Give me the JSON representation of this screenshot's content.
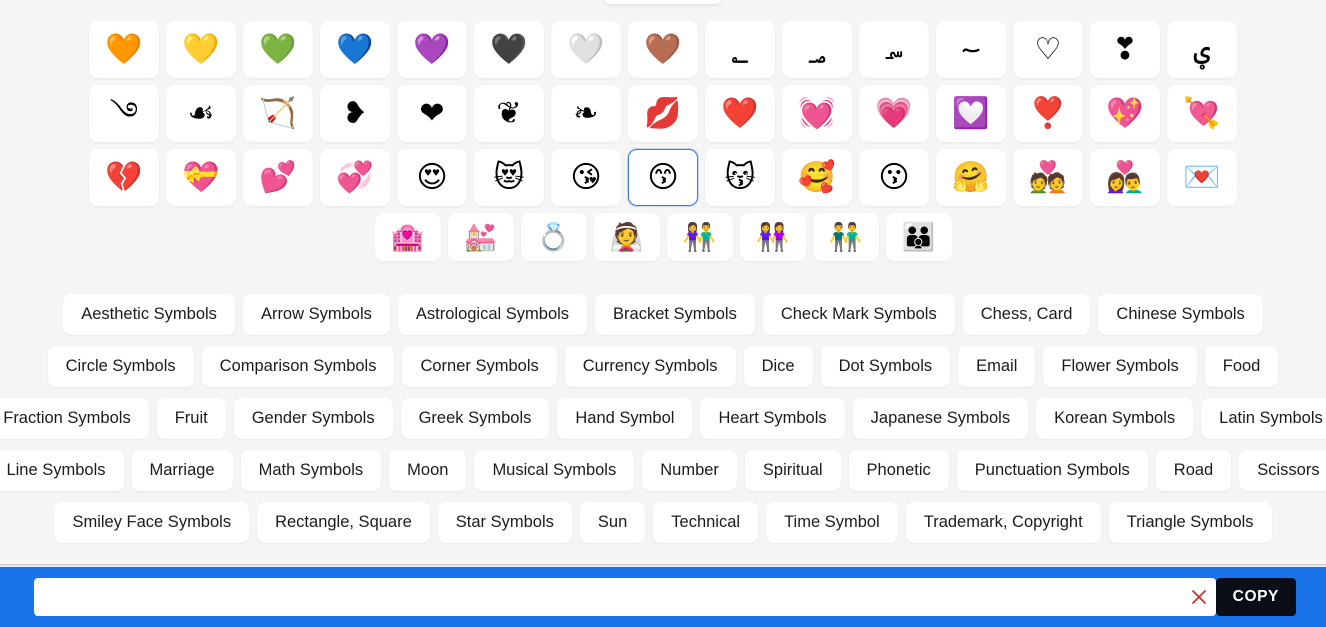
{
  "emoji_grid": {
    "rows": [
      {
        "cells": [
          {
            "glyph": "🧡",
            "name": "orange-heart"
          },
          {
            "glyph": "💛",
            "name": "yellow-heart"
          },
          {
            "glyph": "💚",
            "name": "green-heart"
          },
          {
            "glyph": "💙",
            "name": "blue-heart"
          },
          {
            "glyph": "💜",
            "name": "purple-heart"
          },
          {
            "glyph": "🖤",
            "name": "black-heart"
          },
          {
            "glyph": "🤍",
            "name": "white-heart"
          },
          {
            "glyph": "🤎",
            "name": "brown-heart"
          },
          {
            "glyph": "؂",
            "name": "arabic-footnote-marker-heart"
          },
          {
            "glyph": "؃",
            "name": "arabic-sign-safha-heart"
          },
          {
            "glyph": "؄",
            "name": "arabic-sign-samvat-heart"
          },
          {
            "glyph": "؅",
            "name": "arabic-number-mark-heart"
          },
          {
            "glyph": "♡",
            "name": "white-heart-suit"
          },
          {
            "glyph": "❣",
            "name": "heavy-heart-exclamation-outline"
          },
          {
            "glyph": "ؠ",
            "name": "arabic-letter-kashmiri-yeh-heart"
          }
        ]
      },
      {
        "cells": [
          {
            "glyph": "࿓",
            "name": "tibetan-heart-mark"
          },
          {
            "glyph": "☙",
            "name": "reversed-rotated-floral-heart"
          },
          {
            "glyph": "🏹",
            "name": "bow-and-arrow"
          },
          {
            "glyph": "❥",
            "name": "rotated-heavy-black-heart"
          },
          {
            "glyph": "❤",
            "name": "heavy-black-heart"
          },
          {
            "glyph": "❦",
            "name": "floral-heart"
          },
          {
            "glyph": "❧",
            "name": "rotated-floral-heart-bullet"
          },
          {
            "glyph": "💋",
            "name": "kiss-mark"
          },
          {
            "glyph": "❤️",
            "name": "red-heart"
          },
          {
            "glyph": "💓",
            "name": "beating-heart"
          },
          {
            "glyph": "💗",
            "name": "growing-heart"
          },
          {
            "glyph": "💟",
            "name": "heart-decoration"
          },
          {
            "glyph": "❣️",
            "name": "heart-exclamation"
          },
          {
            "glyph": "💖",
            "name": "sparkling-heart"
          },
          {
            "glyph": "💘",
            "name": "heart-with-arrow"
          }
        ]
      },
      {
        "cells": [
          {
            "glyph": "💔",
            "name": "broken-heart"
          },
          {
            "glyph": "💝",
            "name": "heart-with-ribbon"
          },
          {
            "glyph": "💕",
            "name": "two-hearts"
          },
          {
            "glyph": "💞",
            "name": "revolving-hearts"
          },
          {
            "glyph": "😍",
            "name": "smiling-face-with-heart-eyes"
          },
          {
            "glyph": "😻",
            "name": "smiling-cat-with-heart-eyes"
          },
          {
            "glyph": "😘",
            "name": "face-blowing-a-kiss"
          },
          {
            "glyph": "😙",
            "name": "kissing-face-with-smiling-eyes",
            "selected": true
          },
          {
            "glyph": "😽",
            "name": "kissing-cat"
          },
          {
            "glyph": "🥰",
            "name": "smiling-face-with-hearts"
          },
          {
            "glyph": "😗",
            "name": "kissing-face"
          },
          {
            "glyph": "🤗",
            "name": "smiling-face-with-open-hands"
          },
          {
            "glyph": "💑",
            "name": "couple-with-heart"
          },
          {
            "glyph": "👩‍❤️‍👨",
            "name": "couple-with-heart-woman-man"
          },
          {
            "glyph": "💌",
            "name": "love-letter"
          }
        ]
      },
      {
        "small": true,
        "cells": [
          {
            "glyph": "🏩",
            "name": "love-hotel"
          },
          {
            "glyph": "💒",
            "name": "wedding-chapel"
          },
          {
            "glyph": "💍",
            "name": "ring"
          },
          {
            "glyph": "👰",
            "name": "bride-with-veil"
          },
          {
            "glyph": "👫",
            "name": "woman-and-man-holding-hands"
          },
          {
            "glyph": "👭",
            "name": "women-holding-hands"
          },
          {
            "glyph": "👬",
            "name": "men-holding-hands"
          },
          {
            "glyph": "👪",
            "name": "family"
          }
        ]
      }
    ]
  },
  "categories": {
    "rows": [
      [
        "Aesthetic Symbols",
        "Arrow Symbols",
        "Astrological Symbols",
        "Bracket Symbols",
        "Check Mark Symbols",
        "Chess, Card",
        "Chinese Symbols"
      ],
      [
        "Circle Symbols",
        "Comparison Symbols",
        "Corner Symbols",
        "Currency Symbols",
        "Dice",
        "Dot Symbols",
        "Email",
        "Flower Symbols",
        "Food"
      ],
      [
        "Fraction Symbols",
        "Fruit",
        "Gender Symbols",
        "Greek Symbols",
        "Hand Symbol",
        "Heart Symbols",
        "Japanese Symbols",
        "Korean Symbols",
        "Latin Symbols"
      ],
      [
        "Line Symbols",
        "Marriage",
        "Math Symbols",
        "Moon",
        "Musical Symbols",
        "Number",
        "Spiritual",
        "Phonetic",
        "Punctuation Symbols",
        "Road",
        "Scissors"
      ],
      [
        "Smiley Face Symbols",
        "Rectangle, Square",
        "Star Symbols",
        "Sun",
        "Technical",
        "Time Symbol",
        "Trademark, Copyright",
        "Triangle Symbols"
      ]
    ]
  },
  "bottom_bar": {
    "input_value": "",
    "input_placeholder": "",
    "clear_label": "✕",
    "copy_label": "COPY",
    "accent_color": "#1a73e8",
    "copy_button_color": "#0b0e17",
    "clear_icon_color": "#c0392b"
  }
}
